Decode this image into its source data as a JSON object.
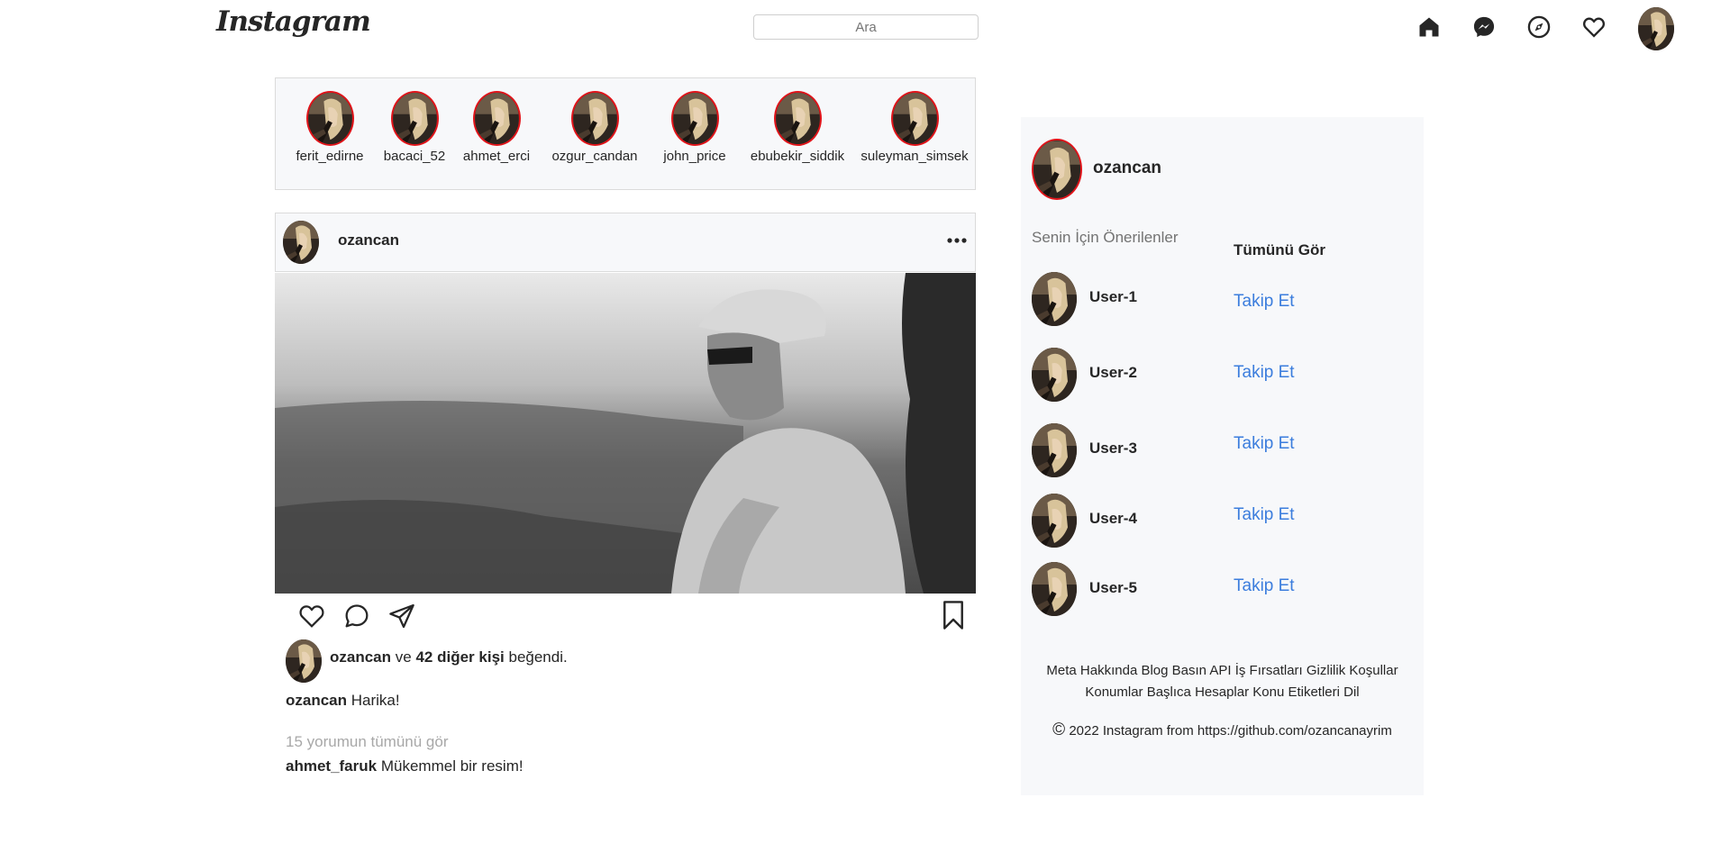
{
  "header": {
    "logo": "Instagram",
    "search_placeholder": "Ara"
  },
  "nav_icons": [
    "home-icon",
    "messenger-icon",
    "explore-icon",
    "heart-icon",
    "profile-avatar"
  ],
  "stories": [
    {
      "username": "ferit_edirne"
    },
    {
      "username": "bacaci_52"
    },
    {
      "username": "ahmet_erci"
    },
    {
      "username": "ozgur_candan"
    },
    {
      "username": "john_price"
    },
    {
      "username": "ebubekir_siddik"
    },
    {
      "username": "suleyman_simsek"
    }
  ],
  "post": {
    "author": "ozancan",
    "more_icon": "more-horizontal-icon",
    "likes": {
      "first_user": "ozancan",
      "connector": "ve",
      "others": "42 diğer kişi",
      "suffix": "beğendi."
    },
    "caption": {
      "user": "ozancan",
      "text": "Harika!"
    },
    "view_comments": "15 yorumun tümünü gör",
    "comment": {
      "user": "ahmet_faruk",
      "text": "Mükemmel bir resim!"
    }
  },
  "sidebar": {
    "username": "ozancan",
    "suggestions_title": "Senin İçin Önerilenler",
    "see_all": "Tümünü Gör",
    "suggestions": [
      {
        "username": "User-1",
        "action": "Takip Et"
      },
      {
        "username": "User-2",
        "action": "Takip Et"
      },
      {
        "username": "User-3",
        "action": "Takip Et"
      },
      {
        "username": "User-4",
        "action": "Takip Et"
      },
      {
        "username": "User-5",
        "action": "Takip Et"
      }
    ],
    "footer_line1": "Meta Hakkında Blog Basın API İş Fırsatları Gizlilik Koşullar",
    "footer_line2": "Konumlar Başlıca Hesaplar Konu Etiketleri Dil",
    "copyright_symbol": "©",
    "copyright": "2022 Instagram from https://github.com/ozancanayrim"
  },
  "colors": {
    "accent_link": "#3b7ddd",
    "story_ring": "#e1141a",
    "panel_bg": "#f7f8fa"
  }
}
